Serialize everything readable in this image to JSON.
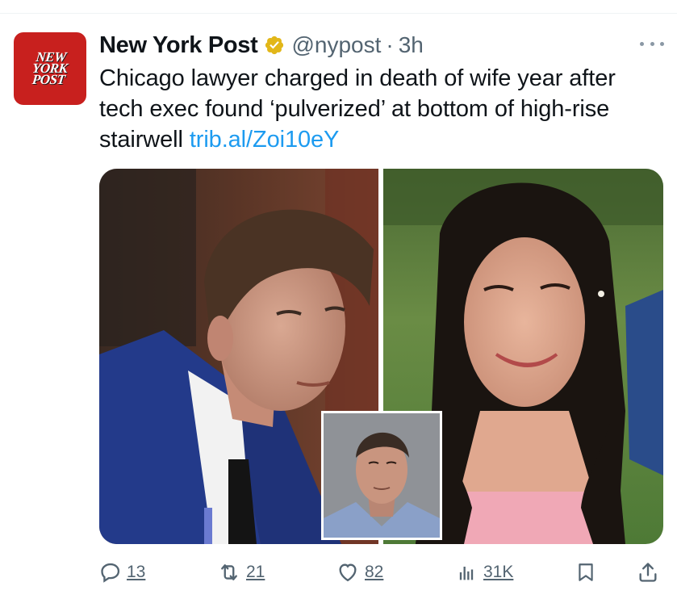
{
  "author": {
    "display_name": "New York Post",
    "handle": "@nypost",
    "separator": "·",
    "time": "3h",
    "avatar_logo": [
      "NEW",
      "YORK",
      "POST"
    ],
    "verified_color": "#e2b719"
  },
  "tweet": {
    "text": "Chicago lawyer charged in death of wife year after tech exec found ‘pulverized’ at bottom of high-rise stairwell",
    "link": "trib.al/Zoi10eY",
    "link_color": "#1d9bf0"
  },
  "media": {
    "left_image": "photo-man-in-blue-suit",
    "right_image": "photo-smiling-woman",
    "inset_image": "mugshot-man"
  },
  "actions": {
    "reply": {
      "icon": "reply-icon",
      "count": "13"
    },
    "retweet": {
      "icon": "retweet-icon",
      "count": "21"
    },
    "like": {
      "icon": "heart-icon",
      "count": "82"
    },
    "views": {
      "icon": "views-icon",
      "count": "31K"
    },
    "bookmark": {
      "icon": "bookmark-icon"
    },
    "share": {
      "icon": "share-icon"
    }
  }
}
